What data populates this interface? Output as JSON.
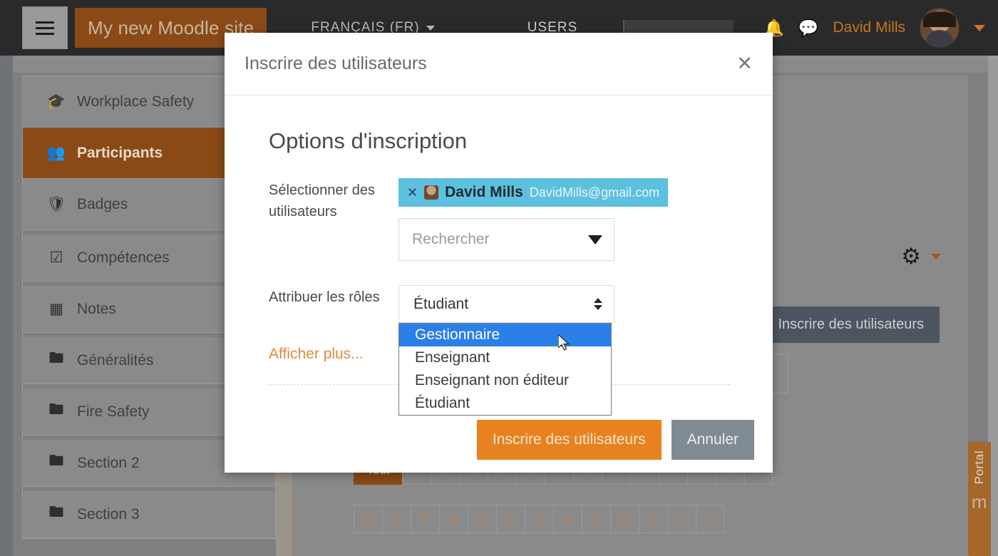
{
  "navbar": {
    "menu_icon": "hamburger-icon",
    "brand": "My new Moodle site",
    "language": "FRANÇAIS (FR)",
    "users_link": "USERS",
    "notification_icon": "bell-icon",
    "messages_icon": "chat-bubble-icon",
    "user_name": "David Mills",
    "avatar_icon": "user-avatar",
    "caret_icon": "chevron-down-icon"
  },
  "sidebar": {
    "items": [
      {
        "label": "Workplace Safety",
        "icon": "graduation-cap-icon",
        "active": false
      },
      {
        "label": "Participants",
        "icon": "users-icon",
        "active": true
      },
      {
        "label": "Badges",
        "icon": "shield-icon",
        "active": false
      },
      {
        "label": "Compétences",
        "icon": "checkbox-icon",
        "active": false
      },
      {
        "label": "Notes",
        "icon": "table-icon",
        "active": false
      },
      {
        "label": "Généralités",
        "icon": "folder-icon",
        "active": false
      },
      {
        "label": "Fire Safety",
        "icon": "folder-icon",
        "active": false
      },
      {
        "label": "Section 2",
        "icon": "folder-icon",
        "active": false
      },
      {
        "label": "Section 3",
        "icon": "folder-icon",
        "active": false
      }
    ]
  },
  "main": {
    "gear_icon": "gear-icon",
    "gear_caret_icon": "chevron-down-icon",
    "enrol_button": "Inscrire des utilisateurs",
    "alpha_row_1": [
      "Tout",
      "A",
      "B",
      "C",
      "D",
      "E",
      "F",
      "G",
      "H",
      "I",
      "J",
      "K",
      "L",
      "M"
    ],
    "alpha_row_2": [
      "N",
      "O",
      "P",
      "Q",
      "R",
      "S",
      "T",
      "U",
      "V",
      "W",
      "X",
      "Y",
      "Z"
    ],
    "alpha_selected": "Tout",
    "portal_label": "Portal",
    "portal_mark": "m"
  },
  "modal": {
    "title": "Inscrire des utilisateurs",
    "close_icon": "close-icon",
    "section_title": "Options d'inscription",
    "select_users": {
      "label": "Sélectionner des utilisateurs",
      "chip": {
        "remove_icon": "remove-chip-icon",
        "avatar_icon": "user-avatar",
        "name": "David Mills",
        "email": "DavidMills@gmail.com"
      },
      "search_placeholder": "Rechercher",
      "search_value": "",
      "dropdown_icon": "triangle-down-icon"
    },
    "assign_roles": {
      "label": "Attribuer les rôles",
      "selected": "Étudiant",
      "stepper_icon": "updown-stepper-icon",
      "options": [
        {
          "label": "Gestionnaire",
          "highlighted": true
        },
        {
          "label": "Enseignant",
          "highlighted": false
        },
        {
          "label": "Enseignant non éditeur",
          "highlighted": false
        },
        {
          "label": "Étudiant",
          "highlighted": false
        }
      ]
    },
    "show_more": "Afficher plus...",
    "submit_button": "Inscrire des utilisateurs",
    "cancel_button": "Annuler"
  },
  "colors": {
    "brand_orange": "#e8821e",
    "navbar_dark": "#2a2a2a",
    "dimmed_orange": "#8a4a17",
    "highlight_blue": "#2a7fe8",
    "chip_blue": "#5cc0de",
    "cancel_gray": "#7f8a92"
  }
}
